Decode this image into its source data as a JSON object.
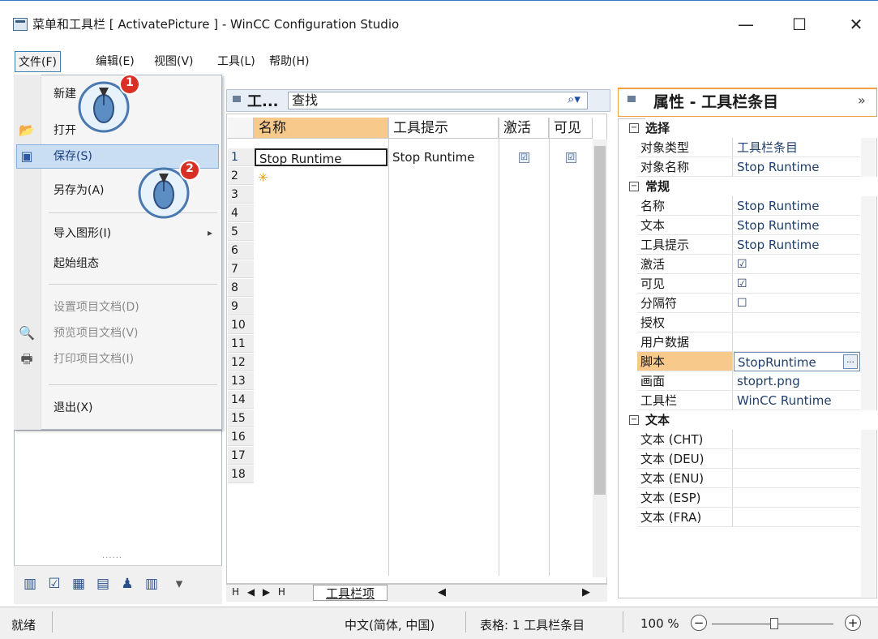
{
  "window": {
    "title": "菜单和工具栏 [ ActivatePicture ] - WinCC Configuration Studio",
    "minimize_glyph": "—",
    "maximize_glyph": "☐",
    "close_glyph": "✕"
  },
  "menubar": {
    "items": [
      "文件(F)",
      "编辑(E)",
      "视图(V)",
      "工具(L)",
      "帮助(H)"
    ]
  },
  "file_menu": {
    "items": [
      "新建",
      "打开",
      "保存(S)",
      "另存为(A)",
      "导入图形(I)",
      "起始组态",
      "设置项目文档(D)",
      "预览项目文档(V)",
      "打印项目文档(I)",
      "退出(X)"
    ],
    "submenu_arrow": "▸"
  },
  "callouts": [
    "1",
    "2"
  ],
  "grid": {
    "title": "工...",
    "search_placeholder": "查找",
    "columns": [
      "名称",
      "工具提示",
      "激活",
      "可见"
    ],
    "rows": [
      {
        "num": "1",
        "name": "Stop Runtime",
        "tooltip": "Stop Runtime",
        "active": "☑",
        "visible": "☑"
      }
    ],
    "new_row_marker": "✳",
    "row_numbers": [
      "2",
      "3",
      "4",
      "5",
      "6",
      "7",
      "8",
      "9",
      "10",
      "11",
      "12",
      "13",
      "14",
      "15",
      "16",
      "17",
      "18"
    ],
    "sheet_tab": "工具栏项",
    "nav_glyphs": "H ◀ ▶ H"
  },
  "properties": {
    "title": "属性 - 工具栏条目",
    "expand_glyph": "»",
    "categories": {
      "selection": "选择",
      "general": "常规",
      "text": "文本"
    },
    "selection_rows": [
      {
        "name": "对象类型",
        "value": "工具栏条目"
      },
      {
        "name": "对象名称",
        "value": "Stop Runtime"
      }
    ],
    "general_rows": [
      {
        "name": "名称",
        "value": "Stop Runtime"
      },
      {
        "name": "文本",
        "value": "Stop Runtime"
      },
      {
        "name": "工具提示",
        "value": "Stop Runtime"
      },
      {
        "name": "激活",
        "value": "☑"
      },
      {
        "name": "可见",
        "value": "☑"
      },
      {
        "name": "分隔符",
        "value": "☐"
      },
      {
        "name": "授权",
        "value": ""
      },
      {
        "name": "用户数据",
        "value": ""
      },
      {
        "name": "脚本",
        "value": "StopRuntime"
      },
      {
        "name": "画面",
        "value": "stoprt.png"
      },
      {
        "name": "工具栏",
        "value": "WinCC Runtime"
      }
    ],
    "text_rows": [
      {
        "name": "文本 (CHT)",
        "value": ""
      },
      {
        "name": "文本 (DEU)",
        "value": ""
      },
      {
        "name": "文本 (ENU)",
        "value": ""
      },
      {
        "name": "文本 (ESP)",
        "value": ""
      },
      {
        "name": "文本 (FRA)",
        "value": ""
      }
    ],
    "script_button": "..."
  },
  "statusbar": {
    "ready": "就绪",
    "language": "中文(简体, 中国)",
    "table_info": "表格: 1 工具栏条目",
    "zoom": "100 %",
    "zoom_minus": "−",
    "zoom_plus": "+"
  },
  "colors": {
    "accent": "#f0a040",
    "selection_header": "#f7c98a",
    "menu_highlight": "#c9ddf3",
    "callout_red": "#d93025"
  }
}
